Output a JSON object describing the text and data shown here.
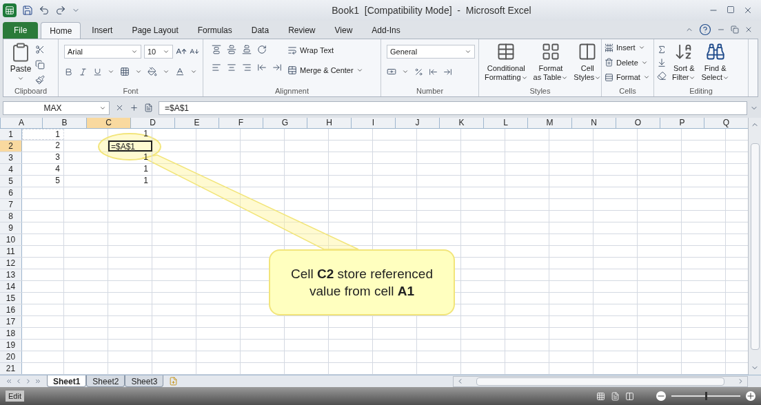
{
  "window": {
    "title": "Book1  [Compatibility Mode]  -  Microsoft Excel"
  },
  "ribbon_tabs": [
    {
      "label": "File",
      "kind": "file",
      "selected": false
    },
    {
      "label": "Home",
      "kind": "tab",
      "selected": true
    },
    {
      "label": "Insert",
      "kind": "tab",
      "selected": false
    },
    {
      "label": "Page Layout",
      "kind": "tab",
      "selected": false
    },
    {
      "label": "Formulas",
      "kind": "tab",
      "selected": false
    },
    {
      "label": "Data",
      "kind": "tab",
      "selected": false
    },
    {
      "label": "Review",
      "kind": "tab",
      "selected": false
    },
    {
      "label": "View",
      "kind": "tab",
      "selected": false
    },
    {
      "label": "Add-Ins",
      "kind": "tab",
      "selected": false
    }
  ],
  "ribbon": {
    "clipboard": {
      "label": "Clipboard",
      "paste": "Paste"
    },
    "font": {
      "label": "Font",
      "font_name": "Arial",
      "font_size": "10"
    },
    "alignment": {
      "label": "Alignment",
      "wrap_text": "Wrap Text",
      "merge": "Merge & Center"
    },
    "number": {
      "label": "Number",
      "format": "General"
    },
    "styles": {
      "label": "Styles",
      "buttons": [
        {
          "line1": "Conditional",
          "line2": "Formatting"
        },
        {
          "line1": "Format",
          "line2": "as Table"
        },
        {
          "line1": "Cell",
          "line2": "Styles"
        }
      ]
    },
    "cells": {
      "label": "Cells",
      "buttons": [
        "Insert",
        "Delete",
        "Format"
      ]
    },
    "editing": {
      "label": "Editing",
      "buttons": [
        {
          "line1": "Sort &",
          "line2": "Filter"
        },
        {
          "line1": "Find &",
          "line2": "Select"
        }
      ]
    }
  },
  "formula_bar": {
    "name_box": "MAX",
    "formula": "=$A$1"
  },
  "sheet": {
    "columns": [
      {
        "label": "A",
        "selected": false
      },
      {
        "label": "B",
        "selected": false
      },
      {
        "label": "C",
        "selected": true
      },
      {
        "label": "D",
        "selected": false
      },
      {
        "label": "E",
        "selected": false
      },
      {
        "label": "F",
        "selected": false
      },
      {
        "label": "G",
        "selected": false
      },
      {
        "label": "H",
        "selected": false
      },
      {
        "label": "I",
        "selected": false
      },
      {
        "label": "J",
        "selected": false
      },
      {
        "label": "K",
        "selected": false
      },
      {
        "label": "L",
        "selected": false
      },
      {
        "label": "M",
        "selected": false
      },
      {
        "label": "N",
        "selected": false
      },
      {
        "label": "O",
        "selected": false
      },
      {
        "label": "P",
        "selected": false
      },
      {
        "label": "Q",
        "selected": false
      }
    ],
    "rows": [
      {
        "label": "1",
        "selected": false,
        "referenced": true,
        "editing": false,
        "a": "1",
        "c": "1"
      },
      {
        "label": "2",
        "selected": true,
        "referenced": false,
        "editing": true,
        "a": "2",
        "c": "=$A$1"
      },
      {
        "label": "3",
        "selected": false,
        "referenced": false,
        "editing": false,
        "a": "3",
        "c": "1"
      },
      {
        "label": "4",
        "selected": false,
        "referenced": false,
        "editing": false,
        "a": "4",
        "c": "1"
      },
      {
        "label": "5",
        "selected": false,
        "referenced": false,
        "editing": false,
        "a": "5",
        "c": "1"
      },
      {
        "label": "6",
        "selected": false,
        "referenced": false,
        "editing": false
      },
      {
        "label": "7",
        "selected": false,
        "referenced": false,
        "editing": false
      },
      {
        "label": "8",
        "selected": false,
        "referenced": false,
        "editing": false
      },
      {
        "label": "9",
        "selected": false,
        "referenced": false,
        "editing": false
      },
      {
        "label": "10",
        "selected": false,
        "referenced": false,
        "editing": false
      },
      {
        "label": "11",
        "selected": false,
        "referenced": false,
        "editing": false
      },
      {
        "label": "12",
        "selected": false,
        "referenced": false,
        "editing": false
      },
      {
        "label": "13",
        "selected": false,
        "referenced": false,
        "editing": false
      },
      {
        "label": "14",
        "selected": false,
        "referenced": false,
        "editing": false
      },
      {
        "label": "15",
        "selected": false,
        "referenced": false,
        "editing": false
      },
      {
        "label": "16",
        "selected": false,
        "referenced": false,
        "editing": false
      },
      {
        "label": "17",
        "selected": false,
        "referenced": false,
        "editing": false
      },
      {
        "label": "18",
        "selected": false,
        "referenced": false,
        "editing": false
      },
      {
        "label": "19",
        "selected": false,
        "referenced": false,
        "editing": false
      },
      {
        "label": "20",
        "selected": false,
        "referenced": false,
        "editing": false
      },
      {
        "label": "21",
        "selected": false,
        "referenced": false,
        "editing": false
      }
    ]
  },
  "callout": {
    "text": "Cell **C2** store referenced value from cell **A1**"
  },
  "sheet_tabs": [
    {
      "label": "Sheet1",
      "selected": true
    },
    {
      "label": "Sheet2",
      "selected": false
    },
    {
      "label": "Sheet3",
      "selected": false
    }
  ],
  "status_bar": {
    "mode": "Edit",
    "zoom": {
      "level": 0.5
    }
  }
}
